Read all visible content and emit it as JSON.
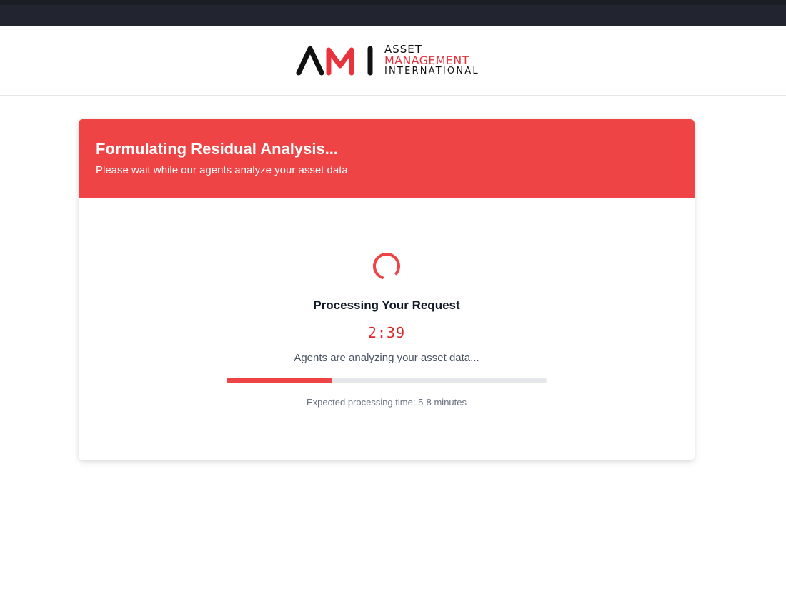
{
  "brand": {
    "logo_text_line1": "ASSET",
    "logo_text_line2": "MANAGEMENT",
    "logo_text_line3": "INTERNATIONAL",
    "logo_mark_icon": "ami-logo-mark",
    "primary_color": "#ef4446",
    "dark_color": "#111111"
  },
  "card": {
    "title": "Formulating Residual Analysis...",
    "subtitle": "Please wait while our agents analyze your asset data"
  },
  "status": {
    "spinner_icon": "loading-spinner-icon",
    "title": "Processing Your Request",
    "timer": "2:39",
    "message": "Agents are analyzing your asset data...",
    "progress_fraction": 0.33,
    "expected_time": "Expected processing time: 5-8 minutes"
  }
}
